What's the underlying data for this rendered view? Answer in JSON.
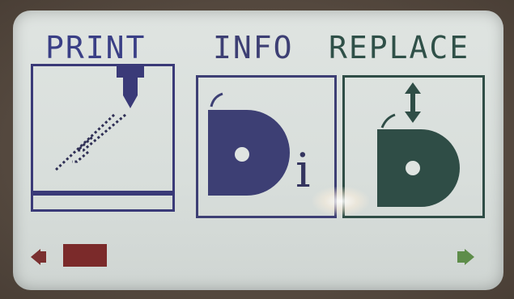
{
  "menu": {
    "items": [
      {
        "label": "PRINT",
        "icon": "print-nozzle-icon"
      },
      {
        "label": "INFO",
        "icon": "filament-info-icon"
      },
      {
        "label": "REPLACE",
        "icon": "filament-replace-icon"
      }
    ],
    "info_glyph": "i",
    "selected_page": 1,
    "page_count": 3
  },
  "navigation": {
    "left_icon": "arrow-left-icon",
    "right_icon": "arrow-right-icon"
  },
  "colors": {
    "lcd_background": "#dfe4e1",
    "print_color": "#3a3a78",
    "info_color": "#3d3f74",
    "replace_color": "#2f4d46",
    "left_arrow": "#7a3030",
    "right_arrow": "#5e8d4a",
    "bezel": "#5f5348"
  }
}
